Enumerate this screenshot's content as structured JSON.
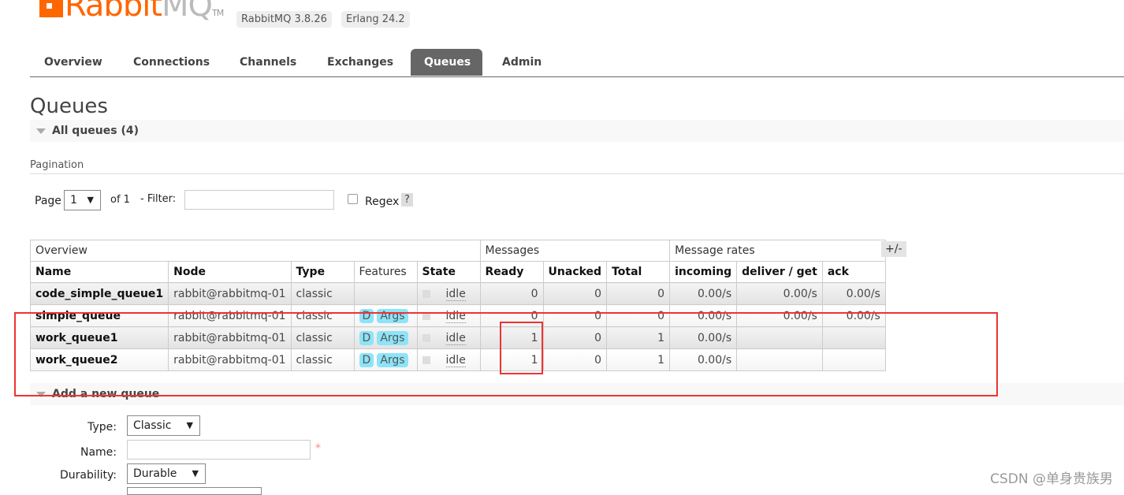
{
  "brand": {
    "logo_main": "Rabbit",
    "logo_mq": "MQ",
    "logo_tm": "TM",
    "version": "RabbitMQ 3.8.26",
    "erlang": "Erlang 24.2"
  },
  "nav": {
    "tabs": [
      {
        "label": "Overview"
      },
      {
        "label": "Connections"
      },
      {
        "label": "Channels"
      },
      {
        "label": "Exchanges"
      },
      {
        "label": "Queues",
        "active": true
      },
      {
        "label": "Admin"
      }
    ]
  },
  "page": {
    "title": "Queues",
    "all_queues": "All queues (4)",
    "pagination": "Pagination"
  },
  "pager": {
    "page_label": "Page",
    "page_value": "1",
    "of_label": "of 1",
    "filter_label": "- Filter:",
    "filter_value": "",
    "regex_label": "Regex",
    "help": "?"
  },
  "table": {
    "groups": [
      "Overview",
      "Messages",
      "Message rates"
    ],
    "headers": [
      "Name",
      "Node",
      "Type",
      "Features",
      "State",
      "Ready",
      "Unacked",
      "Total",
      "incoming",
      "deliver / get",
      "ack"
    ],
    "toggle": "+/-",
    "rows": [
      {
        "name": "code_simple_queue1",
        "node": "rabbit@rabbitmq-01",
        "type": "classic",
        "features": [],
        "state": "idle",
        "ready": "0",
        "unacked": "0",
        "total": "0",
        "incoming": "0.00/s",
        "deliver": "0.00/s",
        "ack": "0.00/s"
      },
      {
        "name": "simple_queue",
        "node": "rabbit@rabbitmq-01",
        "type": "classic",
        "features": [
          "D",
          "Args"
        ],
        "state": "idle",
        "ready": "0",
        "unacked": "0",
        "total": "0",
        "incoming": "0.00/s",
        "deliver": "0.00/s",
        "ack": "0.00/s"
      },
      {
        "name": "work_queue1",
        "node": "rabbit@rabbitmq-01",
        "type": "classic",
        "features": [
          "D",
          "Args"
        ],
        "state": "idle",
        "ready": "1",
        "unacked": "0",
        "total": "1",
        "incoming": "0.00/s",
        "deliver": "",
        "ack": ""
      },
      {
        "name": "work_queue2",
        "node": "rabbit@rabbitmq-01",
        "type": "classic",
        "features": [
          "D",
          "Args"
        ],
        "state": "idle",
        "ready": "1",
        "unacked": "0",
        "total": "1",
        "incoming": "0.00/s",
        "deliver": "",
        "ack": ""
      }
    ]
  },
  "add_queue": {
    "title": "Add a new queue",
    "type_label": "Type:",
    "type_value": "Classic",
    "name_label": "Name:",
    "name_value": "",
    "required": "*",
    "durability_label": "Durability:",
    "durability_value": "Durable"
  },
  "watermark": "CSDN @单身贵族男",
  "colors": {
    "brand": "#ff6600",
    "active_tab": "#666666",
    "badge": "#8de4f8",
    "annotation": "#ee3333"
  }
}
